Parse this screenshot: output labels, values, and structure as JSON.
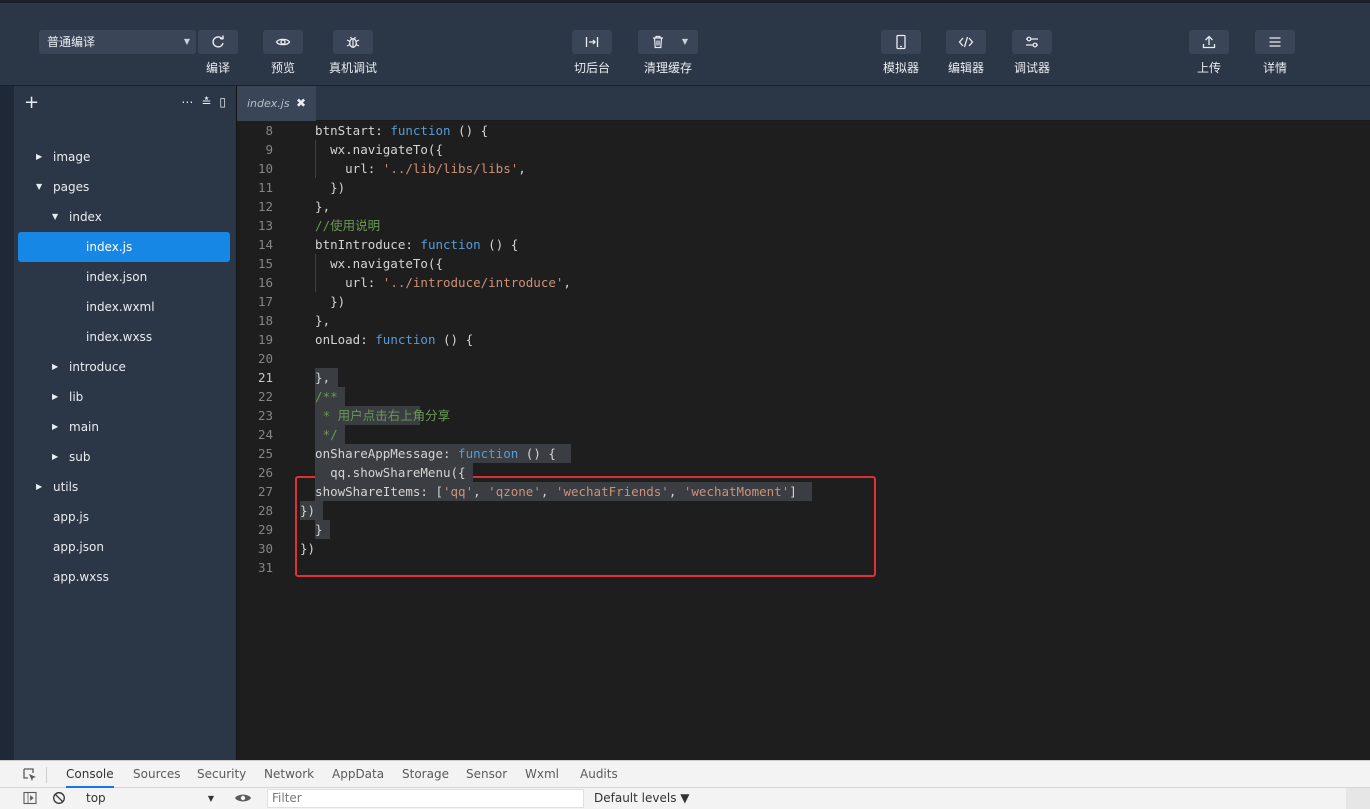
{
  "toolbar": {
    "compile_mode": "普通编译",
    "buttons": [
      {
        "label": "编译",
        "icon": "refresh-icon"
      },
      {
        "label": "预览",
        "icon": "eye-icon"
      },
      {
        "label": "真机调试",
        "icon": "bug-icon"
      },
      {
        "label": "切后台",
        "icon": "switch-icon"
      },
      {
        "label": "清理缓存",
        "icon": "trash-icon"
      },
      {
        "label": "模拟器",
        "icon": "phone-icon"
      },
      {
        "label": "编辑器",
        "icon": "code-icon"
      },
      {
        "label": "调试器",
        "icon": "debug-sliders-icon"
      },
      {
        "label": "上传",
        "icon": "upload-icon"
      },
      {
        "label": "详情",
        "icon": "menu-icon"
      }
    ]
  },
  "sidebar": {
    "tree": [
      {
        "name": "image",
        "type": "folder",
        "expanded": false
      },
      {
        "name": "pages",
        "type": "folder",
        "expanded": true
      },
      {
        "name": "index",
        "type": "folder",
        "expanded": true
      },
      {
        "name": "index.js",
        "type": "file",
        "selected": true
      },
      {
        "name": "index.json",
        "type": "file"
      },
      {
        "name": "index.wxml",
        "type": "file"
      },
      {
        "name": "index.wxss",
        "type": "file"
      },
      {
        "name": "introduce",
        "type": "folder",
        "expanded": false
      },
      {
        "name": "lib",
        "type": "folder",
        "expanded": false
      },
      {
        "name": "main",
        "type": "folder",
        "expanded": false
      },
      {
        "name": "sub",
        "type": "folder",
        "expanded": false
      },
      {
        "name": "utils",
        "type": "folder",
        "expanded": false
      },
      {
        "name": "app.js",
        "type": "file"
      },
      {
        "name": "app.json",
        "type": "file"
      },
      {
        "name": "app.wxss",
        "type": "file"
      }
    ]
  },
  "editor": {
    "tab": {
      "name": "index.js"
    },
    "active_line": 21,
    "lines": [
      {
        "n": "8",
        "code": "  btnStart: function () {"
      },
      {
        "n": "9",
        "code": "    wx.navigateTo({"
      },
      {
        "n": "10",
        "code": "      url: '../lib/libs/libs',"
      },
      {
        "n": "11",
        "code": "    })"
      },
      {
        "n": "12",
        "code": "  },"
      },
      {
        "n": "13",
        "code": "  //使用说明"
      },
      {
        "n": "14",
        "code": "  btnIntroduce: function () {"
      },
      {
        "n": "15",
        "code": "    wx.navigateTo({"
      },
      {
        "n": "16",
        "code": "      url: '../introduce/introduce',"
      },
      {
        "n": "17",
        "code": "    })"
      },
      {
        "n": "18",
        "code": "  },"
      },
      {
        "n": "19",
        "code": "  onLoad: function () {"
      },
      {
        "n": "20",
        "code": ""
      },
      {
        "n": "21",
        "code": "  },"
      },
      {
        "n": "22",
        "code": "  /**"
      },
      {
        "n": "23",
        "code": "   * 用户点击右上角分享"
      },
      {
        "n": "24",
        "code": "   */"
      },
      {
        "n": "25",
        "code": "  onShareAppMessage: function () {"
      },
      {
        "n": "26",
        "code": "    qq.showShareMenu({"
      },
      {
        "n": "27",
        "code": "  showShareItems: ['qq', 'qzone', 'wechatFriends', 'wechatMoment']"
      },
      {
        "n": "28",
        "code": "})"
      },
      {
        "n": "29",
        "code": "  }"
      },
      {
        "n": "30",
        "code": "})"
      },
      {
        "n": "31",
        "code": ""
      }
    ]
  },
  "devtools": {
    "tabs": [
      "Console",
      "Sources",
      "Security",
      "Network",
      "AppData",
      "Storage",
      "Sensor",
      "Wxml",
      "Audits"
    ],
    "active_tab": "Console",
    "context": "top",
    "filter_placeholder": "Filter",
    "levels": "Default levels ▼"
  },
  "colors": {
    "toolbar_bg": "#2b3646",
    "sidebar_bg": "#2b3646",
    "selected_item": "#1787e6",
    "editor_bg": "#1e1e1e",
    "keyword": "#569cd6",
    "string": "#ce9178",
    "comment": "#6a9955",
    "highlight_box": "#e03030"
  }
}
